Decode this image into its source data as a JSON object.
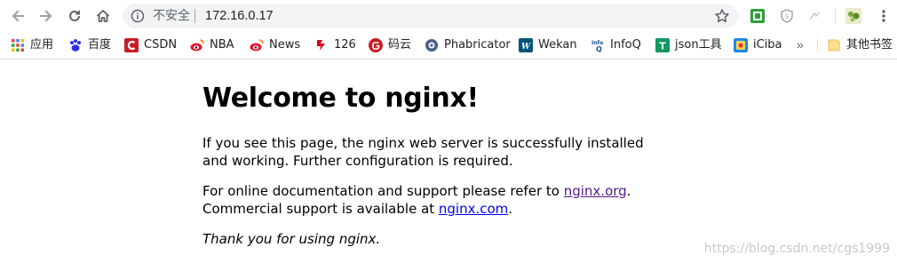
{
  "toolbar": {
    "security_label": "不安全",
    "url": "172.16.0.17"
  },
  "bookmarks": [
    {
      "label": "应用",
      "icon": "apps-grid-icon"
    },
    {
      "label": "百度",
      "icon": "baidu-icon"
    },
    {
      "label": "CSDN",
      "icon": "csdn-icon"
    },
    {
      "label": "NBA",
      "icon": "weibo-icon"
    },
    {
      "label": "News",
      "icon": "weibo-icon"
    },
    {
      "label": "126",
      "icon": "netease-icon"
    },
    {
      "label": "码云",
      "icon": "gitee-icon"
    },
    {
      "label": "Phabricator",
      "icon": "phabricator-icon"
    },
    {
      "label": "Wekan",
      "icon": "wekan-icon"
    },
    {
      "label": "InfoQ",
      "icon": "infoq-icon"
    },
    {
      "label": "json工具",
      "icon": "json-tool-icon"
    },
    {
      "label": "iCiba",
      "icon": "iciba-icon"
    }
  ],
  "bookmarks_more": "»",
  "other_bookmarks": "其他书签",
  "page": {
    "heading": "Welcome to nginx!",
    "para1": "If you see this page, the nginx web server is successfully installed and working. Further configuration is required.",
    "para2_prefix": "For online documentation and support please refer to ",
    "link1": "nginx.org",
    "para2_mid": ".",
    "para3_prefix": "Commercial support is available at ",
    "link2": "nginx.com",
    "para3_suffix": ".",
    "thanks": "Thank you for using nginx."
  },
  "watermark": "https://blog.csdn.net/cgs1999"
}
